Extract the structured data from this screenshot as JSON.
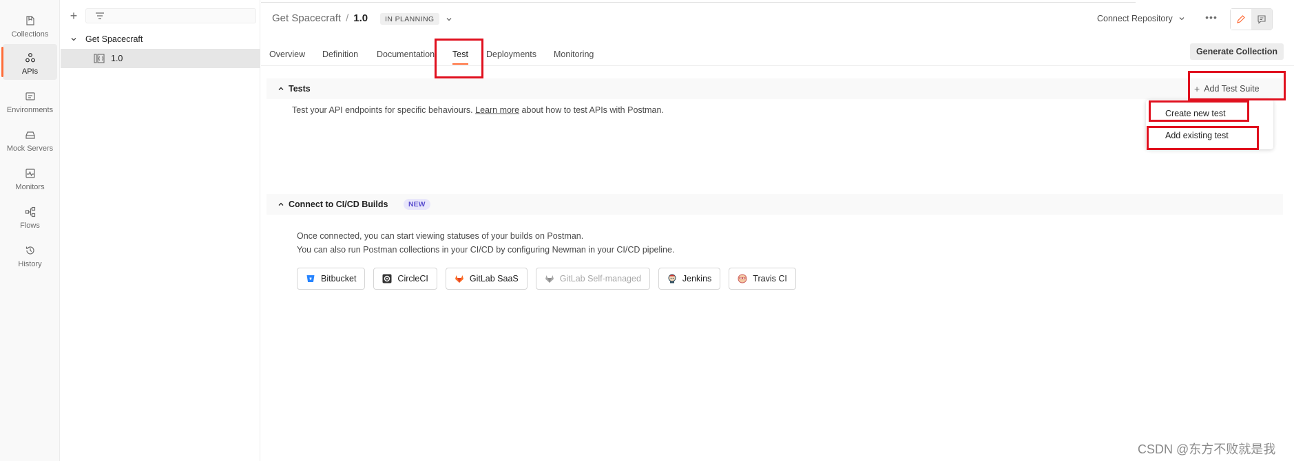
{
  "sidebar": {
    "items": [
      {
        "label": "Collections",
        "icon": "collections-icon",
        "active": false
      },
      {
        "label": "APIs",
        "icon": "apis-icon",
        "active": true
      },
      {
        "label": "Environments",
        "icon": "environments-icon",
        "active": false
      },
      {
        "label": "Mock Servers",
        "icon": "mock-servers-icon",
        "active": false
      },
      {
        "label": "Monitors",
        "icon": "monitors-icon",
        "active": false
      },
      {
        "label": "Flows",
        "icon": "flows-icon",
        "active": false
      },
      {
        "label": "History",
        "icon": "history-icon",
        "active": false
      }
    ]
  },
  "tree": {
    "api_name": "Get Spacecraft",
    "version": "1.0"
  },
  "header": {
    "api_name": "Get Spacecraft",
    "separator": "/",
    "version": "1.0",
    "status": "IN PLANNING",
    "connect_repo": "Connect Repository",
    "more": "•••"
  },
  "tabs": [
    {
      "label": "Overview"
    },
    {
      "label": "Definition"
    },
    {
      "label": "Documentation"
    },
    {
      "label": "Test",
      "active": true
    },
    {
      "label": "Deployments"
    },
    {
      "label": "Monitoring"
    }
  ],
  "generate_collection": "Generate Collection",
  "tests_section": {
    "title": "Tests",
    "desc_before": "Test your API endpoints for specific behaviours.",
    "learn_more": "Learn more",
    "desc_after": "about how to test APIs with Postman.",
    "add_suite": "Add Test Suite",
    "menu": {
      "create": "Create new test",
      "add_existing": "Add existing test"
    }
  },
  "ci_section": {
    "title": "Connect to CI/CD Builds",
    "badge": "NEW",
    "line1": "Once connected, you can start viewing statuses of your builds on Postman.",
    "line2": "You can also run Postman collections in your CI/CD by configuring Newman in your CI/CD pipeline.",
    "providers": [
      {
        "label": "Bitbucket",
        "color": "#2684ff"
      },
      {
        "label": "CircleCI",
        "color": "#343434"
      },
      {
        "label": "GitLab SaaS",
        "color": "#fc6d26"
      },
      {
        "label": "GitLab Self-managed",
        "color": "#a8a8a8",
        "disabled": true
      },
      {
        "label": "Jenkins",
        "color": "#d33833"
      },
      {
        "label": "Travis CI",
        "color": "#cd5c5c"
      }
    ]
  },
  "colors": {
    "accent": "#ff6c37",
    "highlight": "#e0101e"
  },
  "watermark": "CSDN @东方不败就是我"
}
